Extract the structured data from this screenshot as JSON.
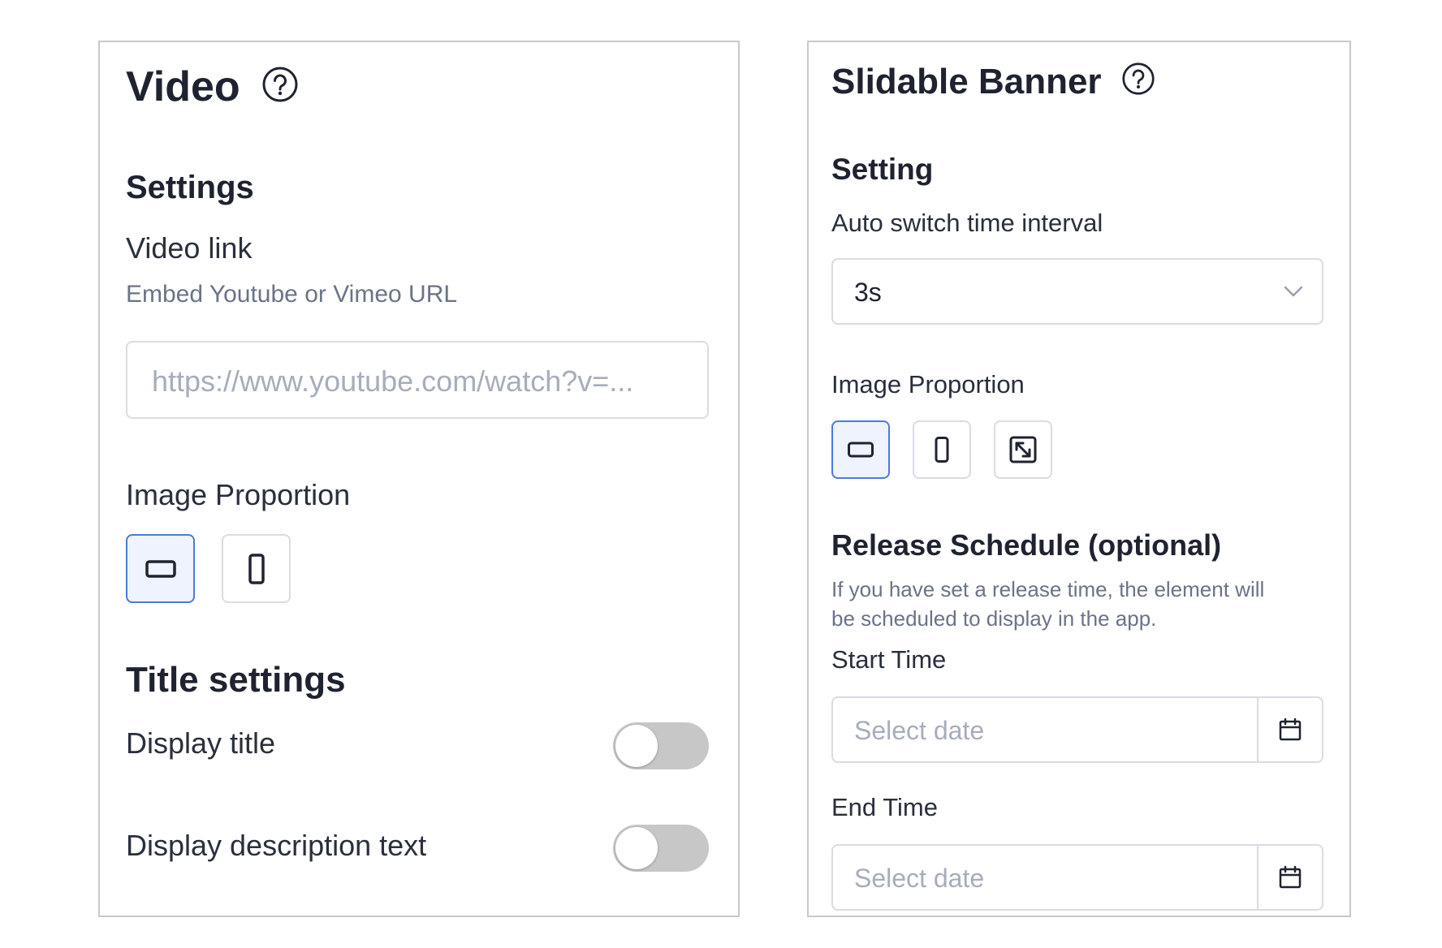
{
  "video_panel": {
    "title": "Video",
    "settings_heading": "Settings",
    "video_link_label": "Video link",
    "video_link_hint": "Embed Youtube or Vimeo URL",
    "video_link_placeholder": "https://www.youtube.com/watch?v=...",
    "image_proportion_label": "Image Proportion",
    "proportion_options": [
      {
        "icon": "landscape-ratio-icon",
        "selected": true
      },
      {
        "icon": "portrait-ratio-icon",
        "selected": false
      }
    ],
    "title_settings_heading": "Title settings",
    "display_title_label": "Display title",
    "display_title_on": false,
    "display_description_label": "Display description text",
    "display_description_on": false
  },
  "banner_panel": {
    "title": "Slidable Banner",
    "setting_heading": "Setting",
    "auto_switch_label": "Auto switch time interval",
    "auto_switch_value": "3s",
    "image_proportion_label": "Image Proportion",
    "proportion_options": [
      {
        "icon": "landscape-ratio-icon",
        "selected": true
      },
      {
        "icon": "portrait-ratio-icon",
        "selected": false
      },
      {
        "icon": "fullscreen-ratio-icon",
        "selected": false
      }
    ],
    "release_heading": "Release Schedule (optional)",
    "release_description_line1": "If you have set a release time, the element will",
    "release_description_line2": "be scheduled to display in the app.",
    "start_time_label": "Start Time",
    "start_time_placeholder": "Select date",
    "end_time_label": "End Time",
    "end_time_placeholder": "Select date"
  },
  "colors": {
    "accent": "#4b7bd9",
    "selected_bg": "#eef3fd",
    "border": "#d9dce3",
    "toggle_off": "#c7c7c7",
    "text": "#1f2330",
    "muted": "#6b7386",
    "placeholder": "#a7adbb"
  }
}
